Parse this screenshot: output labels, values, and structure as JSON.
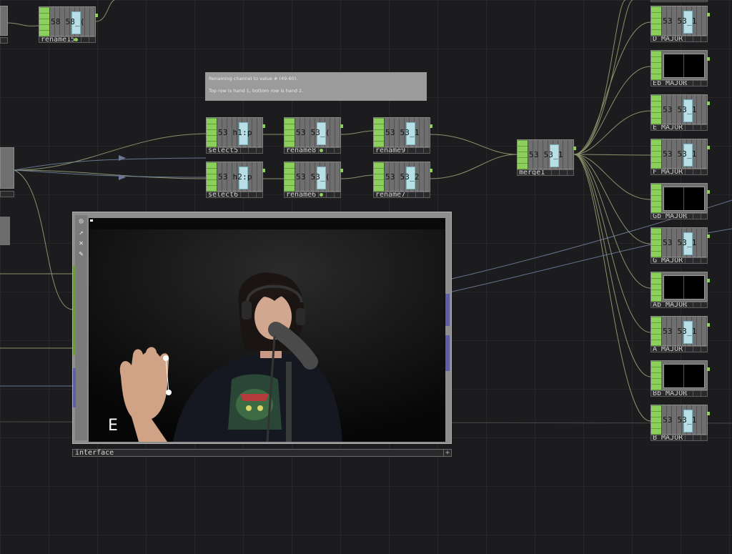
{
  "comment": {
    "line1": "Renaming channel to value # (49-60).",
    "line2": "Top row is hand 1, bottom row is hand 2."
  },
  "nodes": [
    {
      "id": "rename15",
      "label": "rename15",
      "stat": "58 58_("
    },
    {
      "id": "select5",
      "label": "select5",
      "stat": "53 h1:p"
    },
    {
      "id": "rename8",
      "label": "rename8",
      "stat": "53 53_("
    },
    {
      "id": "rename9",
      "label": "rename9",
      "stat": "53 53_1"
    },
    {
      "id": "select6",
      "label": "select6",
      "stat": "53 h2:p"
    },
    {
      "id": "rename6",
      "label": "rename6",
      "stat": "53 53_("
    },
    {
      "id": "rename7",
      "label": "rename7",
      "stat": "53 53_2"
    },
    {
      "id": "merge1",
      "label": "merge1",
      "stat": "53 53_1"
    },
    {
      "id": "D_MAJOR",
      "label": "D_MAJOR",
      "stat": "53 53_1"
    },
    {
      "id": "Eb_MAJOR",
      "label": "Eb_MAJOR",
      "stat": ""
    },
    {
      "id": "E_MAJOR",
      "label": "E_MAJOR",
      "stat": "53 53_1"
    },
    {
      "id": "F_MAJOR",
      "label": "F_MAJOR",
      "stat": "53 53_1"
    },
    {
      "id": "Gb_MAJOR",
      "label": "Gb_MAJOR",
      "stat": ""
    },
    {
      "id": "G_MAJOR",
      "label": "G_MAJOR",
      "stat": "53 53_1"
    },
    {
      "id": "Ab_MAJOR",
      "label": "Ab_MAJOR",
      "stat": ""
    },
    {
      "id": "A_MAJOR",
      "label": "A_MAJOR",
      "stat": "53 53_1"
    },
    {
      "id": "Bb_MAJOR",
      "label": "Bb_MAJOR",
      "stat": ""
    },
    {
      "id": "B_MAJOR",
      "label": "B_MAJOR",
      "stat": "53 53_1"
    }
  ],
  "interface": {
    "label": "interface",
    "overlay_letter": "E",
    "plus": "+"
  },
  "colors": {
    "background": "#1c1c1e",
    "node_flag": "#8ccf5c",
    "wire": "#b9c98a",
    "wire_blue": "#7a8aa8"
  }
}
